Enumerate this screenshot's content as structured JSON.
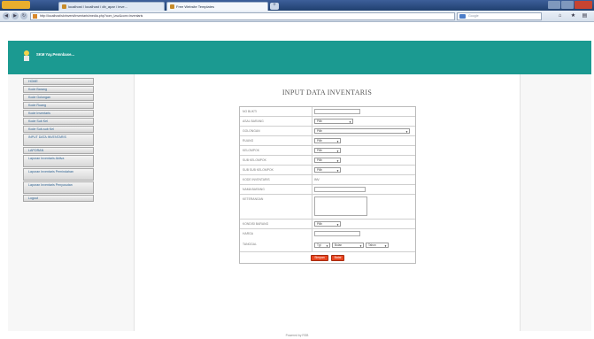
{
  "browser": {
    "tabs": [
      {
        "label": "localhost / localhost / db_apar / inve..."
      },
      {
        "label": "Free Website Templates"
      }
    ],
    "new_tab_symbol": "+",
    "url": "http://localhost/skrinvent/inventaris/media.php?com_lzsz&com=inventaris",
    "search_placeholder": "Google",
    "icons": [
      "back-icon",
      "forward-icon",
      "home-icon",
      "bookmark-icon"
    ]
  },
  "site": {
    "title": "SKM Yay.Pemnbase..."
  },
  "sidebar": {
    "items": [
      {
        "label": "HOME"
      },
      {
        "label": "Kode Barang"
      },
      {
        "label": "Kode Golongan"
      },
      {
        "label": "Kode Ruang"
      },
      {
        "label": "Kode Inventaris"
      },
      {
        "label": "Kode Sub Kel"
      },
      {
        "label": "Kode Sub-sub Kel"
      },
      {
        "label": "INPUT DATA INVENTARIS"
      },
      {
        "label": "LAPORAN"
      },
      {
        "label": "Laporan Inventaris Aktiva"
      },
      {
        "label": "Laporan Inventaris Pemindahan"
      },
      {
        "label": "Laporan Inventaris Penyusutan"
      },
      {
        "label": "Logout"
      }
    ]
  },
  "form": {
    "title": "INPUT DATA INVENTARIS",
    "rows": [
      {
        "label": "NO BUKTI",
        "type": "text"
      },
      {
        "label": "ASAL BARANG",
        "type": "select",
        "value": "Pilih"
      },
      {
        "label": "GOLONGAN",
        "type": "select-wide",
        "value": "Pilih"
      },
      {
        "label": "RUANG",
        "type": "select",
        "value": "Pilih"
      },
      {
        "label": "KELOMPOK",
        "type": "select",
        "value": "Pilih"
      },
      {
        "label": "SUB KELOMPOK",
        "type": "select",
        "value": "Pilih"
      },
      {
        "label": "SUB SUB KELOMPOK",
        "type": "select",
        "value": "Pilih"
      },
      {
        "label": "KODE INVENTARIS",
        "type": "static",
        "value": "INV"
      },
      {
        "label": "NAMA BARANG",
        "type": "text"
      },
      {
        "label": "KETERANGAN",
        "type": "textarea"
      },
      {
        "label": "KONDISI BARANG",
        "type": "select",
        "value": "Pilih"
      },
      {
        "label": "HARGA",
        "type": "text"
      },
      {
        "label": "TANGGAL",
        "type": "date",
        "day": "Tgl",
        "month": "Bulan",
        "year": "Tahun"
      }
    ],
    "buttons": {
      "simpan": "Simpan",
      "batal": "Batal"
    }
  },
  "footer": {
    "text": "Powered by RSB"
  },
  "colors": {
    "header": "#1b9a91",
    "button": "#e8441f",
    "link": "#2a5f8f"
  }
}
